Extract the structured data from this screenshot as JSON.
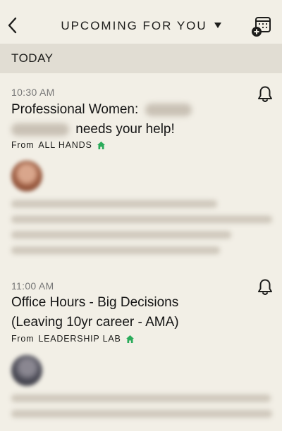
{
  "header": {
    "title": "UPCOMING FOR YOU",
    "back_icon": "chevron-left-icon",
    "title_dropdown_icon": "caret-down-icon",
    "add_calendar_icon": "calendar-add-icon"
  },
  "section": {
    "label": "TODAY"
  },
  "events": [
    {
      "time": "10:30 AM",
      "title_prefix": "Professional Women:",
      "title_suffix": "needs your help!",
      "from_label": "From",
      "org": "ALL HANDS",
      "avatar_color": "#b06a4f"
    },
    {
      "time": "11:00 AM",
      "title_line1": "Office Hours - Big Decisions",
      "title_line2": "(Leaving 10yr career - AMA)",
      "from_label": "From",
      "org": "LEADERSHIP LAB",
      "avatar_color": "#4a4a55"
    }
  ],
  "colors": {
    "background": "#f2efe6",
    "section_bar": "#e1ddd3",
    "home_green": "#2bab5a"
  }
}
